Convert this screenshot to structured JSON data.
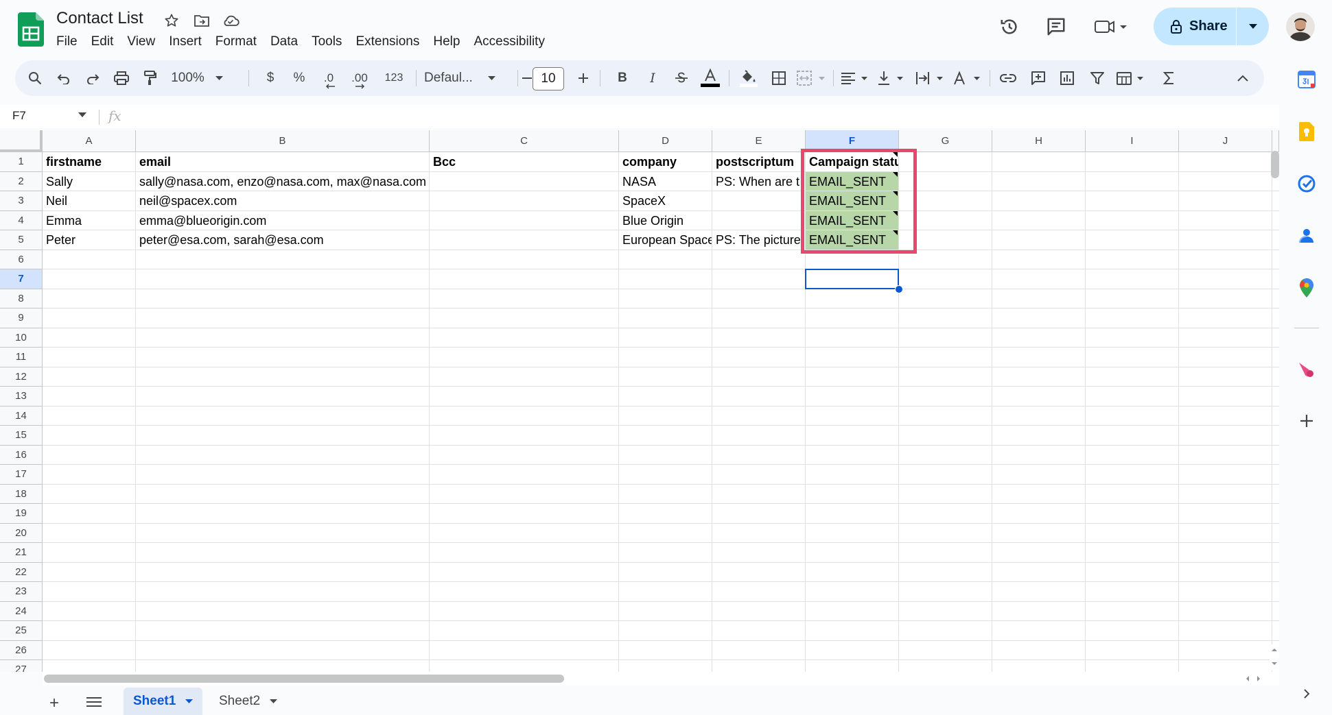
{
  "document": {
    "title": "Contact List",
    "menu": [
      "File",
      "Edit",
      "View",
      "Insert",
      "Format",
      "Data",
      "Tools",
      "Extensions",
      "Help",
      "Accessibility"
    ]
  },
  "header": {
    "share_label": "Share"
  },
  "toolbar": {
    "zoom": "100%",
    "currency": "$",
    "percent": "%",
    "decrease_decimal": ".0",
    "increase_decimal": ".00",
    "number_format": "123",
    "font_family": "Defaul...",
    "font_size": "10",
    "bold": "B",
    "italic": "I"
  },
  "formula_bar": {
    "name_box": "F7",
    "fx_label": "fx",
    "formula": ""
  },
  "sheet": {
    "columns": [
      "A",
      "B",
      "C",
      "D",
      "E",
      "F",
      "G",
      "H",
      "I",
      "J"
    ],
    "selected_column": "F",
    "rows": [
      "1",
      "2",
      "3",
      "4",
      "5",
      "6",
      "7",
      "8",
      "9",
      "10",
      "11",
      "12",
      "13",
      "14",
      "15",
      "16",
      "17",
      "18",
      "19",
      "20",
      "21",
      "22",
      "23",
      "24",
      "25",
      "26",
      "27"
    ],
    "selected_row": "7",
    "headers": {
      "A": "firstname",
      "B": "email",
      "C": "Bcc",
      "D": "company",
      "E": "postscriptum",
      "F": "Campaign status"
    },
    "data": [
      {
        "A": "Sally",
        "B": "sally@nasa.com, enzo@nasa.com, max@nasa.com",
        "C": "",
        "D": "NASA",
        "E": "PS: When are t",
        "F": "EMAIL_SENT"
      },
      {
        "A": "Neil",
        "B": "neil@spacex.com",
        "C": "",
        "D": "SpaceX",
        "E": "",
        "F": "EMAIL_SENT"
      },
      {
        "A": "Emma",
        "B": "emma@blueorigin.com",
        "C": "",
        "D": "Blue Origin",
        "E": "",
        "F": "EMAIL_SENT"
      },
      {
        "A": "Peter",
        "B": "peter@esa.com, sarah@esa.com",
        "C": "",
        "D": "European Space",
        "E": "PS: The picture",
        "F": "EMAIL_SENT"
      }
    ],
    "status_fill_color": "#b7d7a8",
    "highlight_color": "#e8486e"
  },
  "tabs": {
    "add_label": "+",
    "sheets": [
      "Sheet1",
      "Sheet2"
    ],
    "active": "Sheet1"
  },
  "icons": {
    "side_panel": [
      "calendar-icon",
      "keep-icon",
      "tasks-icon",
      "contacts-icon",
      "maps-icon",
      "addon-icon",
      "add-icon"
    ]
  }
}
